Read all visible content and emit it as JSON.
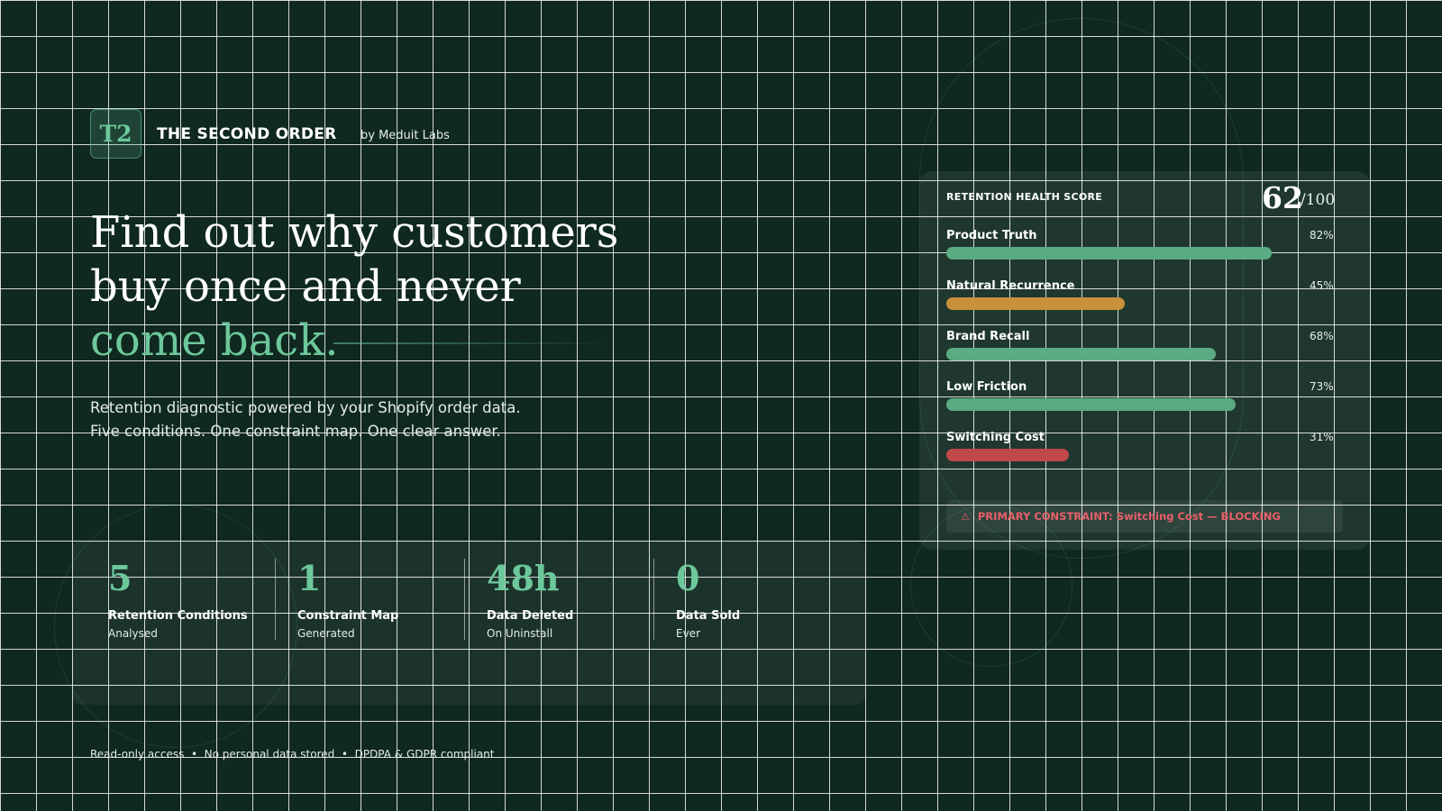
{
  "brand": {
    "logo_text": "T2",
    "title": "THE SECOND ORDER",
    "subtitle": "by Meduit Labs"
  },
  "hero": {
    "line1": "Find out why customers",
    "line2": "buy once and never",
    "accent_line": "come back.",
    "sub_line1": "Retention diagnostic powered by your Shopify order data.",
    "sub_line2": "Five conditions. One constraint map. One clear answer."
  },
  "stats": [
    {
      "value": "5",
      "label": "Retention Conditions",
      "sub": "Analysed"
    },
    {
      "value": "1",
      "label": "Constraint Map",
      "sub": "Generated"
    },
    {
      "value": "48h",
      "label": "Data Deleted",
      "sub": "On Uninstall"
    },
    {
      "value": "0",
      "label": "Data Sold",
      "sub": "Ever"
    }
  ],
  "footer": {
    "note": "Read-only access  •  No personal data stored  •  DPDPA & GDPR compliant"
  },
  "score_card": {
    "title": "RETENTION HEALTH SCORE",
    "score": "62",
    "max": "/100",
    "metrics": [
      {
        "name": "Product Truth",
        "pct_label": "82%",
        "value": 82,
        "color": "#5aaa82"
      },
      {
        "name": "Natural Recurrence",
        "pct_label": "45%",
        "value": 45,
        "color": "#c8903a"
      },
      {
        "name": "Brand Recall",
        "pct_label": "68%",
        "value": 68,
        "color": "#5aaa82"
      },
      {
        "name": "Low Friction",
        "pct_label": "73%",
        "value": 73,
        "color": "#5aaa82"
      },
      {
        "name": "Switching Cost",
        "pct_label": "31%",
        "value": 31,
        "color": "#c04848"
      }
    ],
    "alert_icon": "warning-icon",
    "alert_text": "PRIMARY CONSTRAINT: Switching Cost — BLOCKING"
  },
  "colors": {
    "background": "#0f2820",
    "accent": "#6cc89b",
    "warning": "#c8903a",
    "danger": "#e8606a"
  }
}
